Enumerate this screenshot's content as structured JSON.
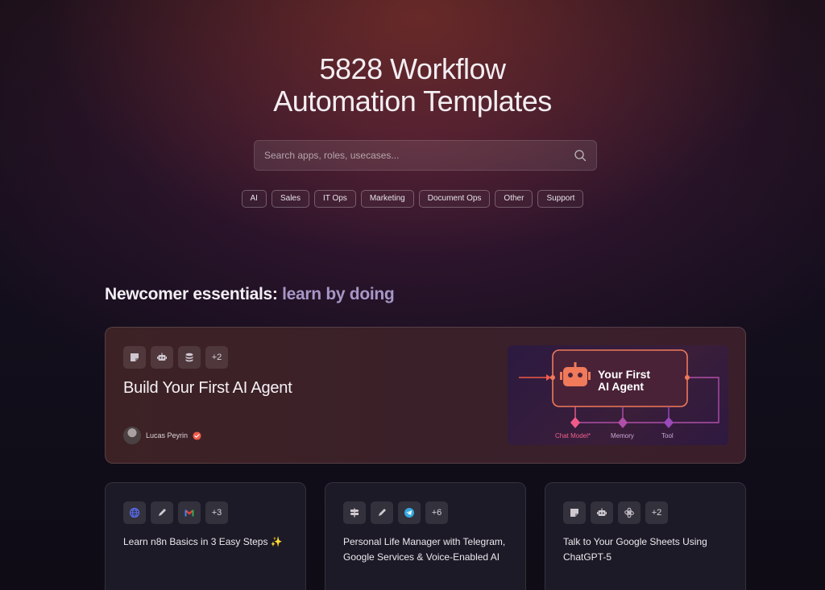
{
  "hero": {
    "title_line1": "5828 Workflow",
    "title_line2": "Automation Templates"
  },
  "search": {
    "placeholder": "Search apps, roles, usecases...",
    "value": ""
  },
  "categories": [
    "AI",
    "Sales",
    "IT Ops",
    "Marketing",
    "Document Ops",
    "Other",
    "Support"
  ],
  "section": {
    "title_a": "Newcomer essentials: ",
    "title_b": "learn by doing"
  },
  "featured": {
    "title": "Build Your First AI Agent",
    "icons": [
      "sticky-note-icon",
      "robot-icon",
      "database-icon"
    ],
    "more": "+2",
    "author": "Lucas Peyrin",
    "diagram": {
      "node_title_line1": "Your First",
      "node_title_line2": "AI Agent",
      "labels": [
        "Chat Model*",
        "Memory",
        "Tool"
      ]
    }
  },
  "cards": [
    {
      "title": "Learn n8n Basics in 3 Easy Steps ✨",
      "icons": [
        "globe-icon",
        "pencil-icon",
        "gmail-icon"
      ],
      "more": "+3"
    },
    {
      "title": "Personal Life Manager with Telegram, Google Services & Voice-Enabled AI",
      "icons": [
        "signpost-icon",
        "pencil-icon",
        "telegram-icon"
      ],
      "more": "+6"
    },
    {
      "title": "Talk to Your Google Sheets Using ChatGPT-5",
      "icons": [
        "sticky-note-icon",
        "robot-icon",
        "openai-icon"
      ],
      "more": "+2"
    }
  ],
  "colors": {
    "accent_red": "#f05a4a",
    "node_border": "#f07a5a",
    "diagram_purple": "#b04fa8"
  }
}
